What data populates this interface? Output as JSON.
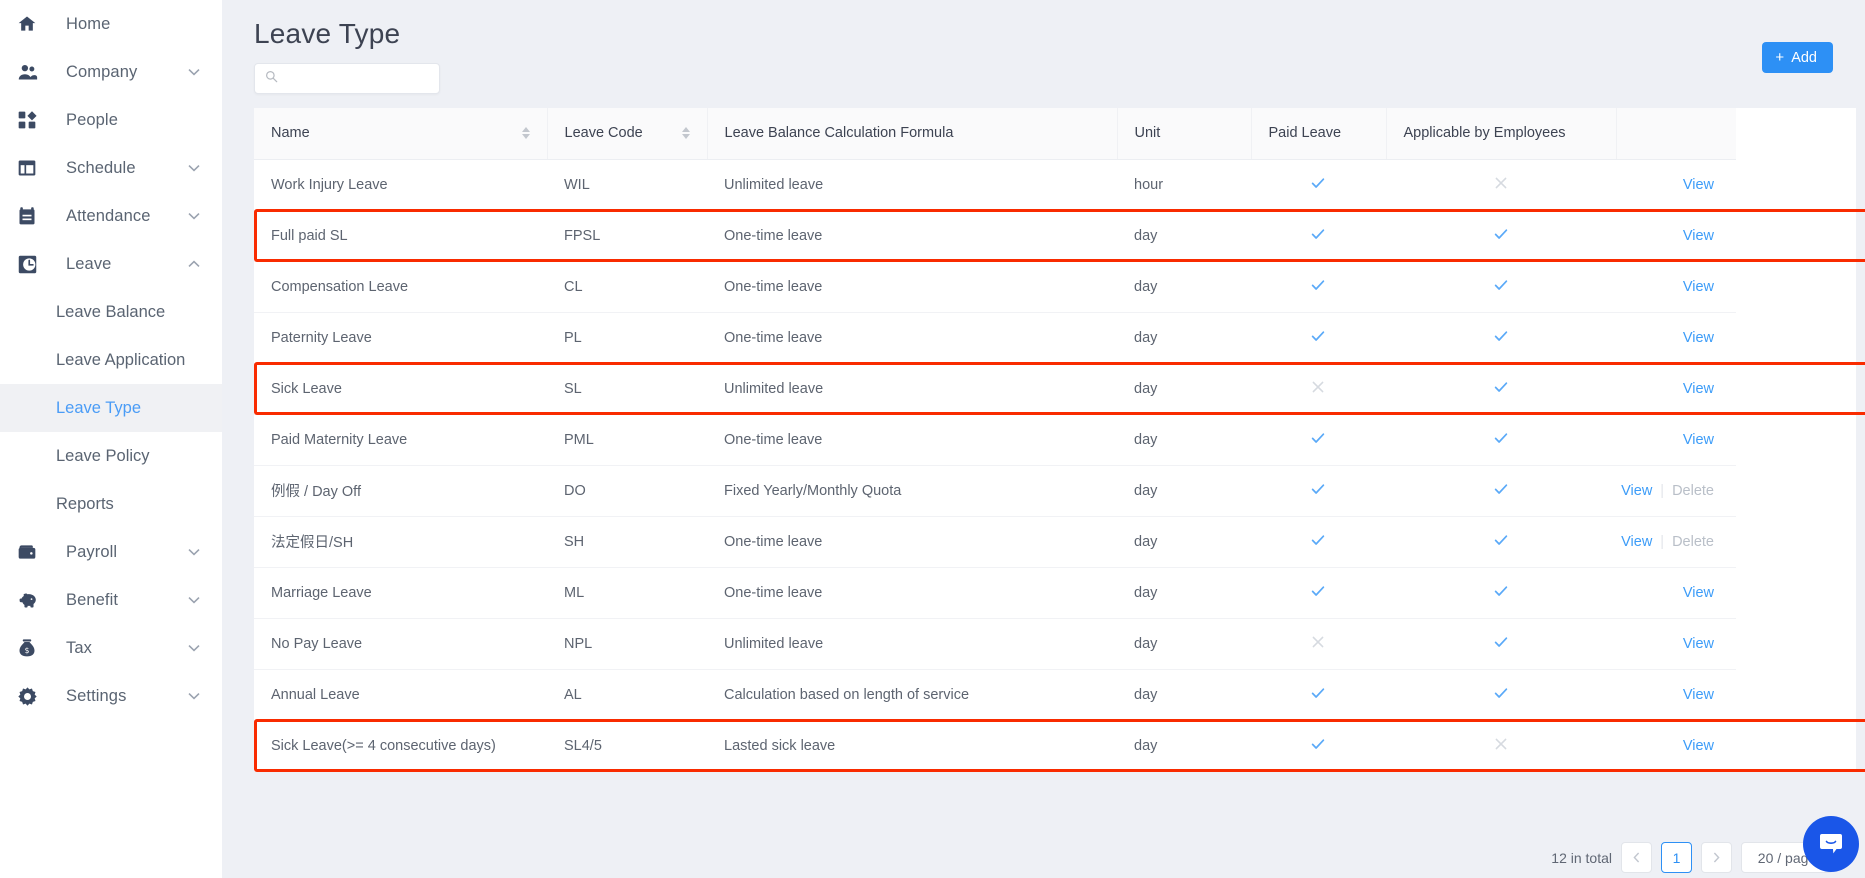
{
  "sidebar": {
    "items": [
      {
        "label": "Home",
        "icon": "home-icon",
        "expandable": false,
        "expanded": false
      },
      {
        "label": "Company",
        "icon": "people-icon",
        "expandable": true,
        "expanded": false
      },
      {
        "label": "People",
        "icon": "grid-icon",
        "expandable": false,
        "expanded": false
      },
      {
        "label": "Schedule",
        "icon": "layout-icon",
        "expandable": true,
        "expanded": false
      },
      {
        "label": "Attendance",
        "icon": "calendar-icon",
        "expandable": true,
        "expanded": false
      },
      {
        "label": "Leave",
        "icon": "clock-icon",
        "expandable": true,
        "expanded": true
      }
    ],
    "leave_children": [
      {
        "label": "Leave Balance",
        "active": false
      },
      {
        "label": "Leave Application",
        "active": false
      },
      {
        "label": "Leave Type",
        "active": true
      },
      {
        "label": "Leave Policy",
        "active": false
      },
      {
        "label": "Reports",
        "active": false
      }
    ],
    "items_bottom": [
      {
        "label": "Payroll",
        "icon": "wallet-icon",
        "expandable": true,
        "expanded": false
      },
      {
        "label": "Benefit",
        "icon": "piggy-icon",
        "expandable": true,
        "expanded": false
      },
      {
        "label": "Tax",
        "icon": "moneybag-icon",
        "expandable": true,
        "expanded": false
      },
      {
        "label": "Settings",
        "icon": "gear-icon",
        "expandable": true,
        "expanded": false
      }
    ]
  },
  "header": {
    "title": "Leave Type",
    "add_label": "Add",
    "add_icon": "plus-icon"
  },
  "search": {
    "value": "",
    "placeholder": "",
    "icon": "search-icon"
  },
  "table": {
    "columns": [
      {
        "label": "Name",
        "sortable": true
      },
      {
        "label": "Leave Code",
        "sortable": true
      },
      {
        "label": "Leave Balance Calculation Formula",
        "sortable": false
      },
      {
        "label": "Unit",
        "sortable": false
      },
      {
        "label": "Paid Leave",
        "sortable": false
      },
      {
        "label": "Applicable by Employees",
        "sortable": false
      },
      {
        "label": "",
        "sortable": false
      }
    ],
    "action_view": "View",
    "action_delete": "Delete",
    "rows": [
      {
        "name": "Work Injury Leave",
        "code": "WIL",
        "formula": "Unlimited leave",
        "unit": "hour",
        "paid": true,
        "applicable": false,
        "view": true,
        "delete": false,
        "highlight": false
      },
      {
        "name": "Full paid SL",
        "code": "FPSL",
        "formula": "One-time leave",
        "unit": "day",
        "paid": true,
        "applicable": true,
        "view": true,
        "delete": false,
        "highlight": true
      },
      {
        "name": "Compensation Leave",
        "code": "CL",
        "formula": "One-time leave",
        "unit": "day",
        "paid": true,
        "applicable": true,
        "view": true,
        "delete": false,
        "highlight": false
      },
      {
        "name": "Paternity Leave",
        "code": "PL",
        "formula": "One-time leave",
        "unit": "day",
        "paid": true,
        "applicable": true,
        "view": true,
        "delete": false,
        "highlight": false
      },
      {
        "name": "Sick Leave",
        "code": "SL",
        "formula": "Unlimited leave",
        "unit": "day",
        "paid": false,
        "applicable": true,
        "view": true,
        "delete": false,
        "highlight": true
      },
      {
        "name": "Paid Maternity Leave",
        "code": "PML",
        "formula": "One-time leave",
        "unit": "day",
        "paid": true,
        "applicable": true,
        "view": true,
        "delete": false,
        "highlight": false
      },
      {
        "name": "例假 / Day Off",
        "code": "DO",
        "formula": "Fixed Yearly/Monthly Quota",
        "unit": "day",
        "paid": true,
        "applicable": true,
        "view": true,
        "delete": true,
        "highlight": false
      },
      {
        "name": "法定假日/SH",
        "code": "SH",
        "formula": "One-time leave",
        "unit": "day",
        "paid": true,
        "applicable": true,
        "view": true,
        "delete": true,
        "highlight": false
      },
      {
        "name": "Marriage Leave",
        "code": "ML",
        "formula": "One-time leave",
        "unit": "day",
        "paid": true,
        "applicable": true,
        "view": true,
        "delete": false,
        "highlight": false
      },
      {
        "name": "No Pay Leave",
        "code": "NPL",
        "formula": "Unlimited leave",
        "unit": "day",
        "paid": false,
        "applicable": true,
        "view": true,
        "delete": false,
        "highlight": false
      },
      {
        "name": "Annual Leave",
        "code": "AL",
        "formula": "Calculation based on length of service",
        "unit": "day",
        "paid": true,
        "applicable": true,
        "view": true,
        "delete": false,
        "highlight": false
      },
      {
        "name": "Sick Leave(>= 4 consecutive days)",
        "code": "SL4/5",
        "formula": "Lasted sick leave",
        "unit": "day",
        "paid": true,
        "applicable": false,
        "view": true,
        "delete": false,
        "highlight": true
      }
    ]
  },
  "pagination": {
    "total_text": "12 in total",
    "prev_icon": "chevron-left-icon",
    "next_icon": "chevron-right-icon",
    "current_page": "1",
    "page_size": "20 / page"
  },
  "chat": {
    "icon": "chat-bubble-icon"
  },
  "colors": {
    "accent": "#2d90f5",
    "link": "#3c9cf8",
    "tick": "#5aa9f8",
    "cross": "#d6dae0",
    "highlight_border": "#f92b00",
    "sidebar_icon": "#3c4a63",
    "chat": "#1a56e8"
  }
}
